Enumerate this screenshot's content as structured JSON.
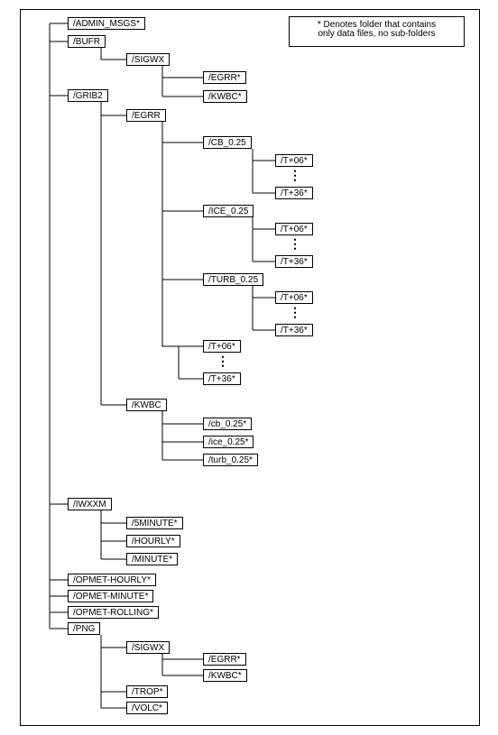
{
  "legend": {
    "line1": "* Denotes folder that contains",
    "line2": "only data files, no sub-folders"
  },
  "nodes": {
    "admin_msgs": "/ADMIN_MSGS*",
    "bufr": "/BUFR",
    "sigwx1": "/SIGWX",
    "egrr1": "/EGRR*",
    "kwbc1": "/KWBC*",
    "grib2": "/GRIB2",
    "egrr2": "/EGRR",
    "cb025": "/CB_0.25",
    "t06a": "/T+06*",
    "t36a": "/T+36*",
    "ice025": "/ICE_0.25",
    "t06b": "/T+06*",
    "t36b": "/T+36*",
    "turb025": "/TURB_0.25",
    "t06c": "/T+06*",
    "t36c": "/T+36*",
    "t06d": "/T+06*",
    "t36d": "/T+36*",
    "kwbc2": "/KWBC",
    "cb025s": "/cb_0.25*",
    "ice025s": "/ice_0.25*",
    "turb025s": "/turb_0.25*",
    "iwxxm": "/IWXXM",
    "fiveminute": "/5MINUTE*",
    "hourly": "/HOURLY*",
    "minute": "/MINUTE*",
    "opmet_hourly": "/OPMET-HOURLY*",
    "opmet_minute": "/OPMET-MINUTE*",
    "opmet_rolling": "/OPMET-ROLLING*",
    "png": "/PNG",
    "sigwx2": "/SIGWX",
    "egrr3": "/EGRR*",
    "kwbc3": "/KWBC*",
    "trop": "/TROP*",
    "volc": "/VOLC*"
  },
  "chart_data": {
    "type": "tree",
    "legend": "* Denotes folder that contains only data files, no sub-folders",
    "root_children": [
      {
        "name": "/ADMIN_MSGS",
        "leaf": true
      },
      {
        "name": "/BUFR",
        "children": [
          {
            "name": "/SIGWX",
            "children": [
              {
                "name": "/EGRR",
                "leaf": true
              },
              {
                "name": "/KWBC",
                "leaf": true
              }
            ]
          }
        ]
      },
      {
        "name": "/GRIB2",
        "children": [
          {
            "name": "/EGRR",
            "children": [
              {
                "name": "/CB_0.25",
                "children": [
                  {
                    "name": "/T+06",
                    "leaf": true
                  },
                  {
                    "name": "...",
                    "ellipsis": true
                  },
                  {
                    "name": "/T+36",
                    "leaf": true
                  }
                ]
              },
              {
                "name": "/ICE_0.25",
                "children": [
                  {
                    "name": "/T+06",
                    "leaf": true
                  },
                  {
                    "name": "...",
                    "ellipsis": true
                  },
                  {
                    "name": "/T+36",
                    "leaf": true
                  }
                ]
              },
              {
                "name": "/TURB_0.25",
                "children": [
                  {
                    "name": "/T+06",
                    "leaf": true
                  },
                  {
                    "name": "...",
                    "ellipsis": true
                  },
                  {
                    "name": "/T+36",
                    "leaf": true
                  }
                ]
              },
              {
                "name": "/T+06",
                "leaf": true
              },
              {
                "name": "...",
                "ellipsis": true
              },
              {
                "name": "/T+36",
                "leaf": true
              }
            ]
          },
          {
            "name": "/KWBC",
            "children": [
              {
                "name": "/cb_0.25",
                "leaf": true
              },
              {
                "name": "/ice_0.25",
                "leaf": true
              },
              {
                "name": "/turb_0.25",
                "leaf": true
              }
            ]
          }
        ]
      },
      {
        "name": "/IWXXM",
        "children": [
          {
            "name": "/5MINUTE",
            "leaf": true
          },
          {
            "name": "/HOURLY",
            "leaf": true
          },
          {
            "name": "/MINUTE",
            "leaf": true
          }
        ]
      },
      {
        "name": "/OPMET-HOURLY",
        "leaf": true
      },
      {
        "name": "/OPMET-MINUTE",
        "leaf": true
      },
      {
        "name": "/OPMET-ROLLING",
        "leaf": true
      },
      {
        "name": "/PNG",
        "children": [
          {
            "name": "/SIGWX",
            "children": [
              {
                "name": "/EGRR",
                "leaf": true
              },
              {
                "name": "/KWBC",
                "leaf": true
              }
            ]
          },
          {
            "name": "/TROP",
            "leaf": true
          },
          {
            "name": "/VOLC",
            "leaf": true
          }
        ]
      }
    ]
  }
}
